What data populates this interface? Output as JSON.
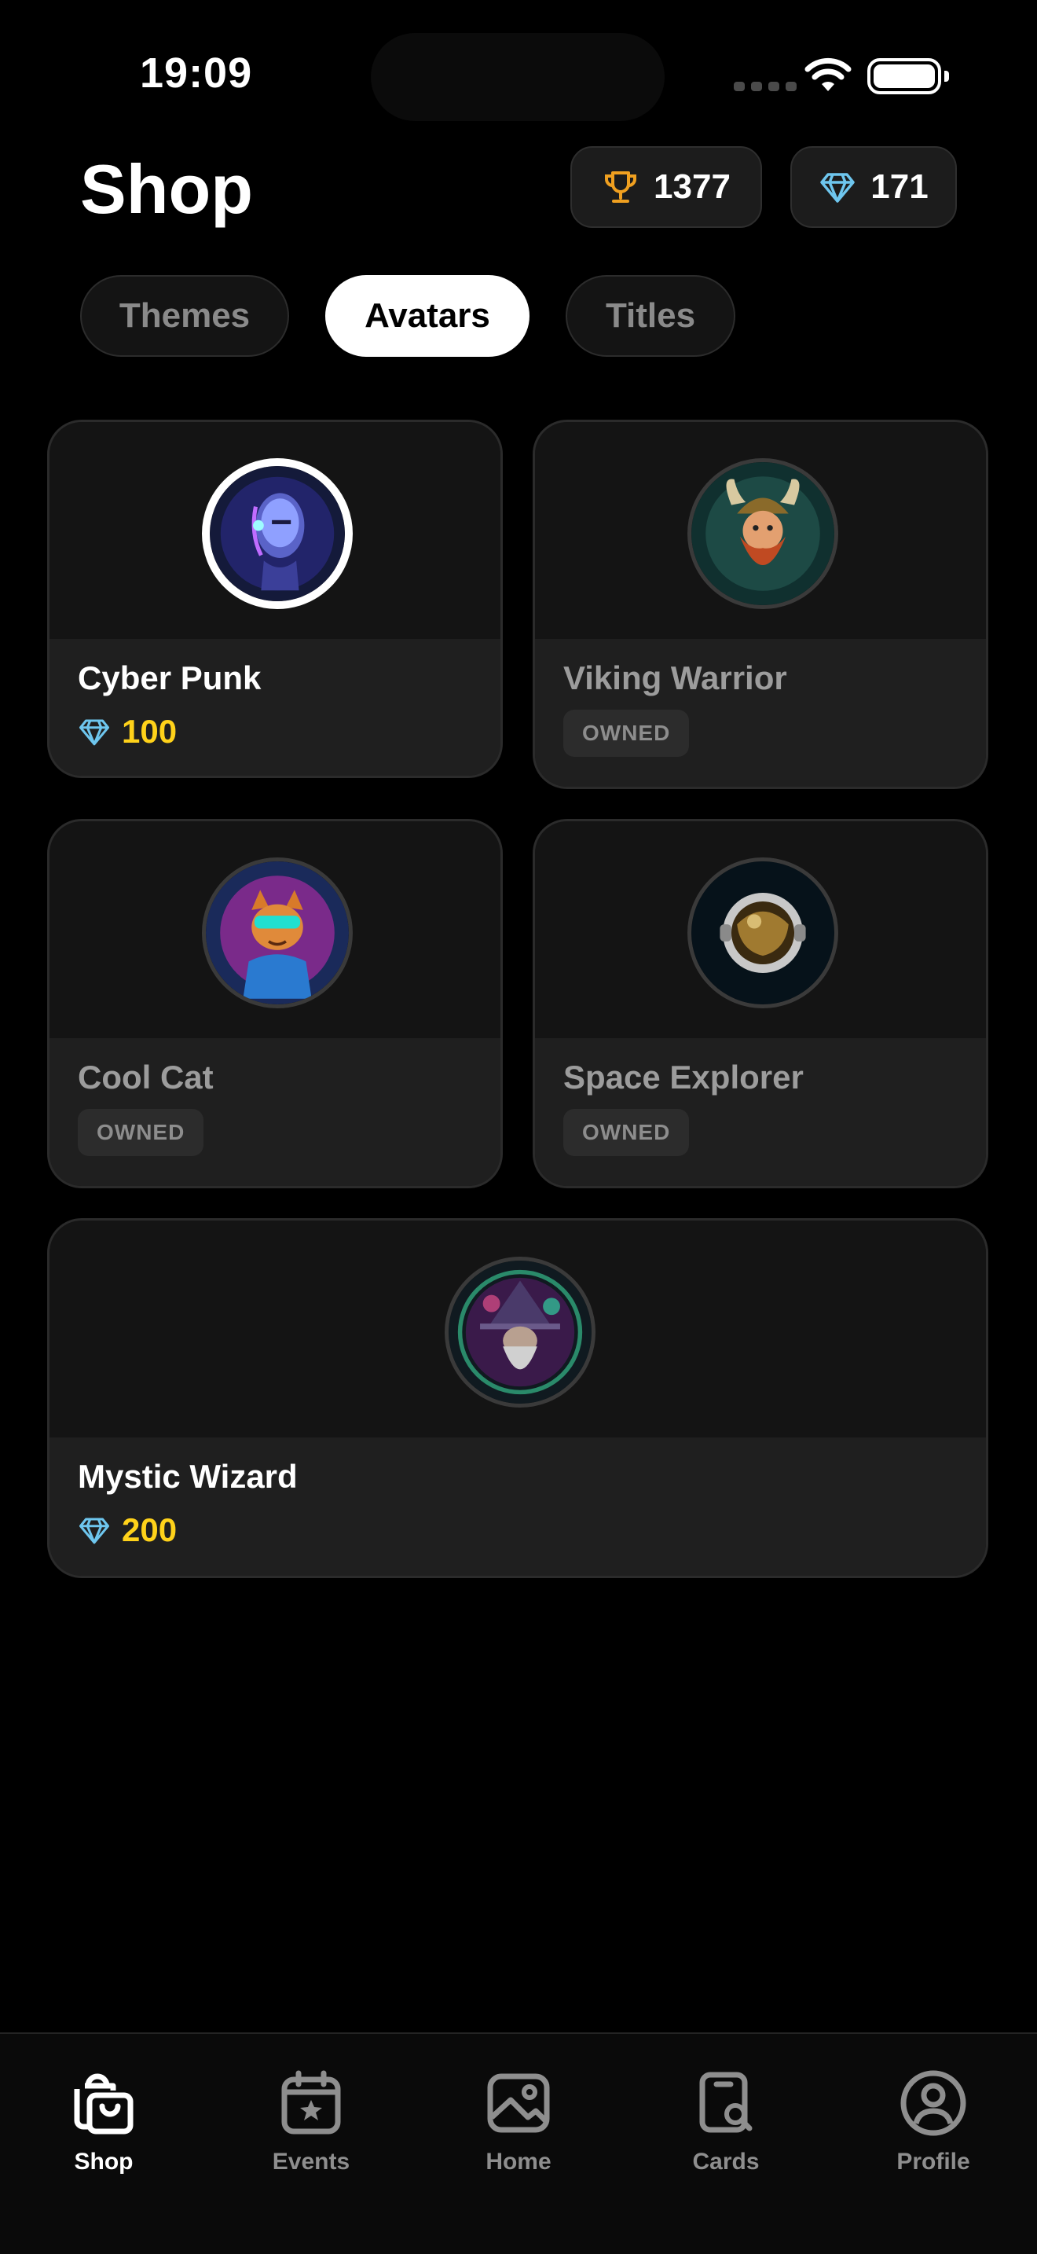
{
  "status_bar": {
    "time": "19:09"
  },
  "header": {
    "title": "Shop",
    "trophies": "1377",
    "gems": "171"
  },
  "tabs": [
    {
      "label": "Themes",
      "active": false
    },
    {
      "label": "Avatars",
      "active": true
    },
    {
      "label": "Titles",
      "active": false
    }
  ],
  "items": [
    {
      "name": "Cyber Punk",
      "price": "100",
      "owned": false,
      "avatar": "cyber-punk-avatar"
    },
    {
      "name": "Viking Warrior",
      "status": "OWNED",
      "owned": true,
      "avatar": "viking-warrior-avatar"
    },
    {
      "name": "Cool Cat",
      "status": "OWNED",
      "owned": true,
      "avatar": "cool-cat-avatar"
    },
    {
      "name": "Space Explorer",
      "status": "OWNED",
      "owned": true,
      "avatar": "space-explorer-avatar"
    },
    {
      "name": "Mystic Wizard",
      "price": "200",
      "owned": false,
      "avatar": "mystic-wizard-avatar"
    }
  ],
  "nav": [
    {
      "label": "Shop",
      "icon": "shopping-bag-icon",
      "active": true
    },
    {
      "label": "Events",
      "icon": "calendar-star-icon",
      "active": false
    },
    {
      "label": "Home",
      "icon": "image-icon",
      "active": false
    },
    {
      "label": "Cards",
      "icon": "card-search-icon",
      "active": false
    },
    {
      "label": "Profile",
      "icon": "profile-icon",
      "active": false
    }
  ],
  "colors": {
    "background": "#000000",
    "price": "#ffd21a",
    "gem": "#6ec6ee",
    "trophy": "#f0a020"
  }
}
